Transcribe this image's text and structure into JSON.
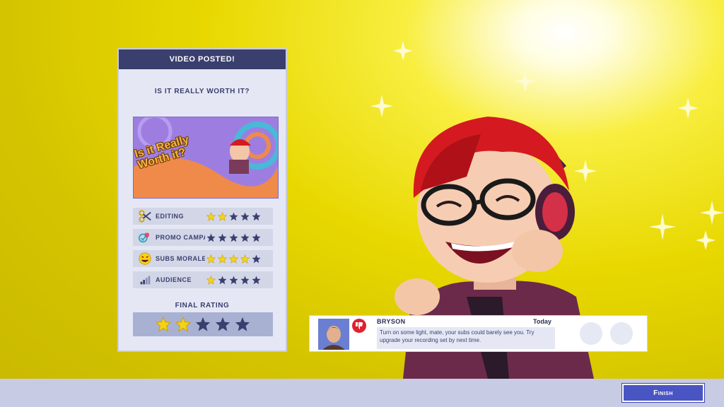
{
  "card": {
    "header": "VIDEO POSTED!",
    "question": "IS IT REALLY WORTH IT?",
    "thumbnail_title": "Is it Really Worth it?",
    "stats": [
      {
        "label": "EDITING",
        "icon": "scissors-icon",
        "stars": 2,
        "max": 5
      },
      {
        "label": "PROMO CAMPAIGN",
        "icon": "promo-icon",
        "stars": 0,
        "max": 5
      },
      {
        "label": "SUBS MORALE",
        "icon": "smiley-icon",
        "stars": 4,
        "max": 5
      },
      {
        "label": "AUDIENCE",
        "icon": "signal-bars-icon",
        "stars": 1,
        "max": 5
      }
    ],
    "final_label": "FINAL RATING",
    "final_stars": 2,
    "final_max": 5
  },
  "comment": {
    "name": "BRYSON",
    "time": "Today",
    "text": "Turn on some light, mate, your subs could barely see you. Try upgrade your recording set by next time.",
    "reaction": "thumbs-down-icon"
  },
  "footer": {
    "finish_label": "Finish"
  },
  "colors": {
    "star_filled": "#f5d21a",
    "star_empty": "#3a3f6e",
    "header_bg": "#3a3f6e",
    "finish_bg": "#4a55c4"
  }
}
